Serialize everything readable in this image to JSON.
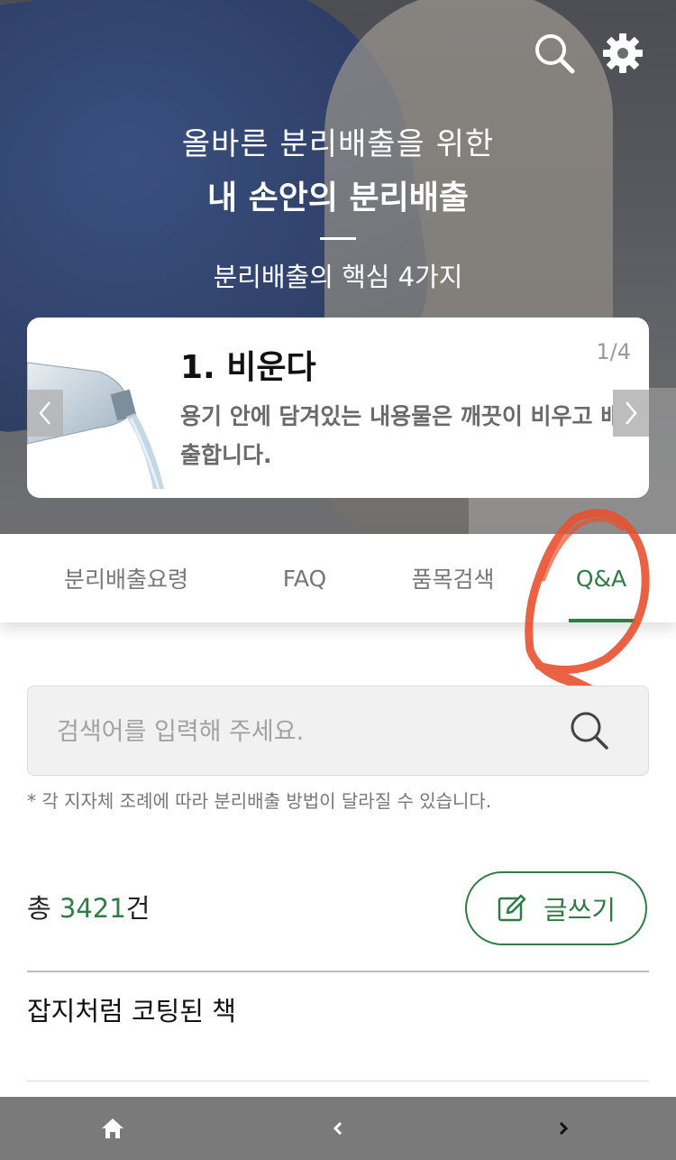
{
  "hero": {
    "subtitle": "올바른 분리배출을 위한",
    "title": "내 손안의 분리배출",
    "core_heading": "분리배출의 핵심 4가지"
  },
  "card": {
    "title": "1. 비운다",
    "page": "1/4",
    "description": "용기 안에 담겨있는 내용물은 깨끗이 비우고 배출합니다."
  },
  "tabs": [
    {
      "label": "분리배출요령",
      "active": false
    },
    {
      "label": "FAQ",
      "active": false
    },
    {
      "label": "품목검색",
      "active": false
    },
    {
      "label": "Q&A",
      "active": true
    }
  ],
  "search": {
    "placeholder": "검색어를 입력해 주세요.",
    "value": ""
  },
  "notice": "* 각 지자체 조례에 따라 분리배출 방법이 달라질 수 있습니다.",
  "count": {
    "prefix": "총 ",
    "number": "3421",
    "suffix": "건"
  },
  "write_button": {
    "label": "글쓰기"
  },
  "list": [
    {
      "title": "잡지처럼 코팅된 책"
    }
  ],
  "icons": {
    "top_search": "search-icon",
    "top_settings": "gear-icon",
    "search_field": "search-icon",
    "write": "edit-icon",
    "nav_home": "home-icon",
    "nav_back": "chevron-left-icon",
    "nav_forward": "chevron-right-icon"
  },
  "colors": {
    "accent": "#2e7d47",
    "annotation": "#e8502f",
    "bottom_bar": "#7a7a7a"
  }
}
